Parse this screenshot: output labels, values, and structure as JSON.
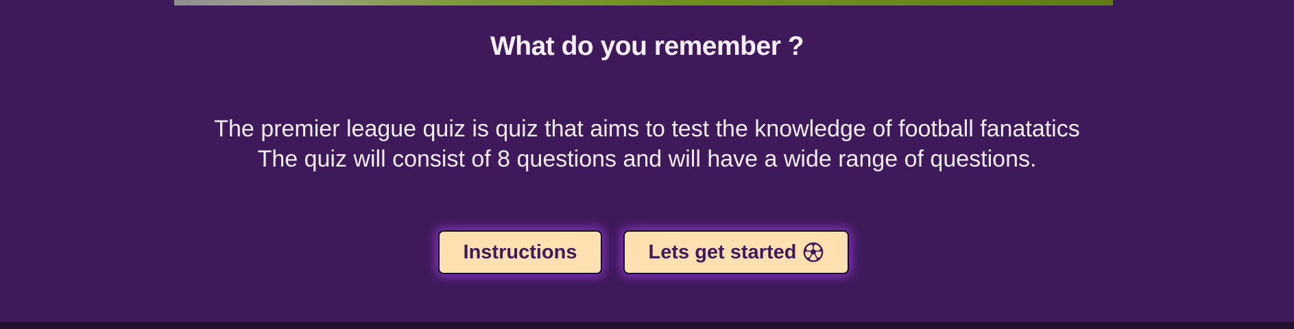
{
  "page": {
    "title": "What do you remember ?",
    "intro_lines": [
      "The premier league quiz is quiz that aims to test the knowledge of football fanatatics",
      "The quiz will consist of 8 questions and will have a wide range of questions."
    ]
  },
  "buttons": {
    "instructions_label": "Instructions",
    "start_label": "Lets get started",
    "start_icon": "soccer-ball-icon"
  },
  "colors": {
    "background": "#3f1a5a",
    "button_fill": "#ffe0b0",
    "button_text": "#3f1a5a",
    "button_glow": "#963cdc",
    "text": "#f6eef9"
  }
}
